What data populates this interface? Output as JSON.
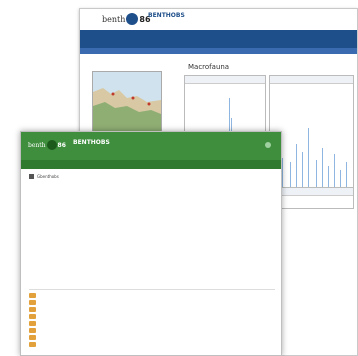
{
  "top_link": "",
  "back_window": {
    "logo": {
      "left": "benth",
      "badge": "",
      "right": "86"
    },
    "brand": {
      "name": "BENTHOBS",
      "tag": ""
    },
    "nav": [],
    "panel_title": "Macrofauna",
    "charts": [
      {
        "title": ""
      },
      {
        "title": ""
      },
      {
        "title": ""
      }
    ]
  },
  "front_window": {
    "logo": {
      "left": "benth",
      "badge": "",
      "right": "86"
    },
    "brand": {
      "name": "BENTHOBS",
      "tag": ""
    },
    "nav": [],
    "breadcrumb": "Gbenthobs",
    "paragraphs": [],
    "tabs": [],
    "files": [
      {
        "name": "",
        "date": "",
        "desc": ""
      },
      {
        "name": "",
        "date": "",
        "desc": ""
      },
      {
        "name": "",
        "date": "",
        "desc": ""
      },
      {
        "name": "",
        "date": "",
        "desc": ""
      },
      {
        "name": "",
        "date": "",
        "desc": ""
      },
      {
        "name": "",
        "date": "",
        "desc": ""
      },
      {
        "name": "",
        "date": "",
        "desc": ""
      },
      {
        "name": "",
        "date": "",
        "desc": ""
      }
    ]
  },
  "colors": {
    "back_header_nav": "#1f4f8a",
    "front_header": "#3e8e3e",
    "chart_bars": "#8fb6e0",
    "folder": "#e2a13b"
  },
  "icons": [
    "logo-badge-icon",
    "gear-icon",
    "folder-icon"
  ]
}
